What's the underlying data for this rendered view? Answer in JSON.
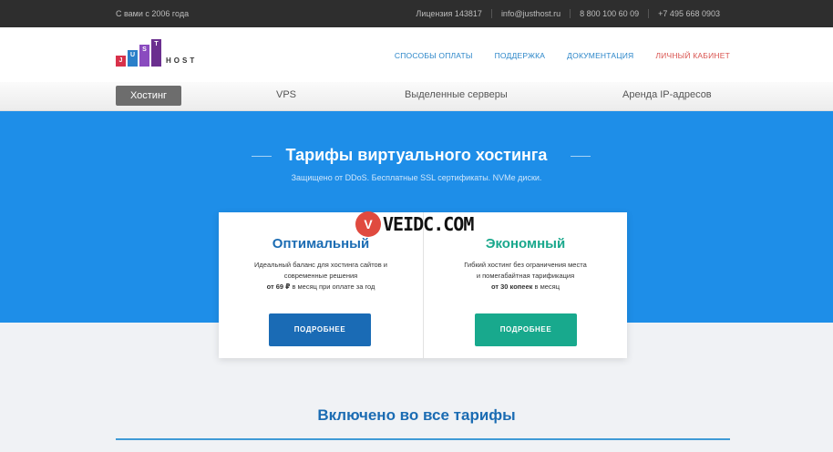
{
  "topbar": {
    "since": "С вами с 2006 года",
    "license": "Лицензия 143817",
    "email": "info@justhost.ru",
    "phone1": "8 800 100 60 09",
    "phone2": "+7 495 668 0903"
  },
  "logo": {
    "letters": [
      "J",
      "U",
      "S",
      "T"
    ],
    "host": "HOST",
    "colors": [
      "#d8314a",
      "#2a7fc9",
      "#8a4bbf",
      "#6b2f8f"
    ]
  },
  "nav": {
    "payment": "СПОСОБЫ ОПЛАТЫ",
    "support": "ПОДДЕРЖКА",
    "docs": "ДОКУМЕНТАЦИЯ",
    "cabinet": "ЛИЧНЫЙ КАБИНЕТ"
  },
  "subnav": {
    "hosting": "Хостинг",
    "vps": "VPS",
    "dedicated": "Выделенные серверы",
    "ip": "Аренда IP-адресов"
  },
  "hero": {
    "title": "Тарифы виртуального хостинга",
    "subtitle": "Защищено от DDoS. Бесплатные SSL сертификаты. NVMe диски."
  },
  "plans": [
    {
      "name": "Оптимальный",
      "desc_line1": "Идеальный баланс для хостинга сайтов и",
      "desc_line2": "современные решения",
      "price": "от 69 ₽",
      "price_suffix": " в месяц при оплате за год",
      "button": "ПОДРОБНЕЕ"
    },
    {
      "name": "Экономный",
      "desc_line1": "Гибкий хостинг без ограничения места",
      "desc_line2": "и помегабайтная тарификация",
      "price": "от 30 копеек",
      "price_suffix": " в месяц",
      "button": "ПОДРОБНЕЕ"
    }
  ],
  "watermark": {
    "seal": "V",
    "text": "VEIDC.COM"
  },
  "included": {
    "title": "Включено во все тарифы"
  },
  "colors": {
    "hero_bg": "#1e8ee8",
    "optimal": "#1a6bb5",
    "economy": "#18a98d",
    "cabinet": "#d9534f"
  }
}
